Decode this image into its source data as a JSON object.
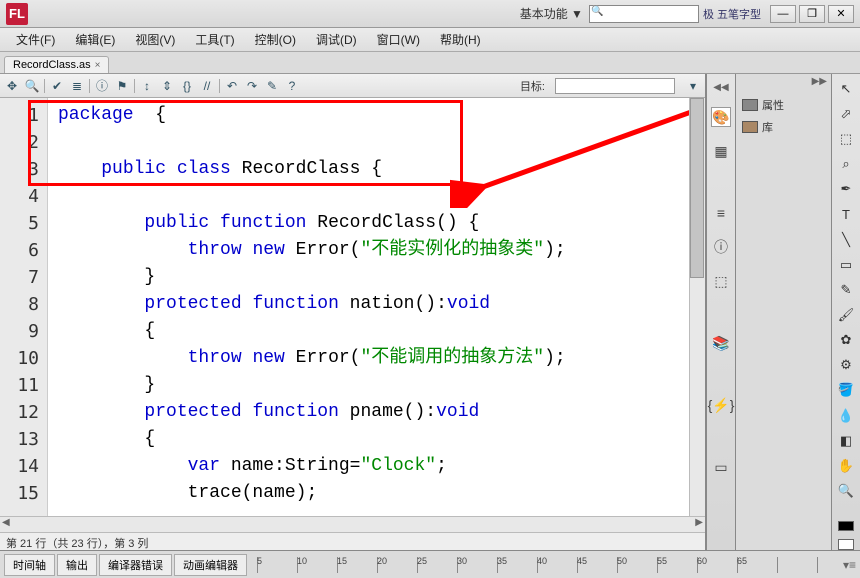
{
  "titlebar": {
    "logo": "FL",
    "mode": "基本功能 ▼",
    "ime": "极 五笔字型"
  },
  "winbtns": {
    "min": "—",
    "restore": "❐",
    "close": "✕"
  },
  "menu": [
    "文件(F)",
    "编辑(E)",
    "视图(V)",
    "工具(T)",
    "控制(O)",
    "调试(D)",
    "窗口(W)",
    "帮助(H)"
  ],
  "tab": {
    "name": "RecordClass.as",
    "close": "×"
  },
  "toolbar": {
    "target_label": "目标:"
  },
  "code_lines": [
    {
      "n": "1",
      "html": "<span class='kw'>package</span>  {"
    },
    {
      "n": "2",
      "html": ""
    },
    {
      "n": "3",
      "html": "    <span class='kw'>public</span> <span class='kw'>class</span> RecordClass {"
    },
    {
      "n": "4",
      "html": ""
    },
    {
      "n": "5",
      "html": "        <span class='kw'>public</span> <span class='kw'>function</span> RecordClass() {"
    },
    {
      "n": "6",
      "html": "            <span class='kw'>throw</span> <span class='kw'>new</span> Error(<span class='str'>\"不能实例化的抽象类\"</span>);"
    },
    {
      "n": "7",
      "html": "        }"
    },
    {
      "n": "8",
      "html": "        <span class='kw'>protected</span> <span class='kw'>function</span> nation():<span class='kw'>void</span>"
    },
    {
      "n": "9",
      "html": "        {"
    },
    {
      "n": "10",
      "html": "            <span class='kw'>throw</span> <span class='kw'>new</span> Error(<span class='str'>\"不能调用的抽象方法\"</span>);"
    },
    {
      "n": "11",
      "html": "        }"
    },
    {
      "n": "12",
      "html": "        <span class='kw'>protected</span> <span class='kw'>function</span> pname():<span class='kw'>void</span>"
    },
    {
      "n": "13",
      "html": "        {"
    },
    {
      "n": "14",
      "html": "            <span class='kw'>var</span> name:String=<span class='str'>\"Clock\"</span>;"
    },
    {
      "n": "15",
      "html": "            trace(name);"
    }
  ],
  "status": "第 21 行（共 23 行），第 3 列",
  "panels": {
    "prop": "属性",
    "lib": "库"
  },
  "bottom_tabs": [
    "时间轴",
    "输出",
    "编译器错误",
    "动画编辑器"
  ],
  "ruler_marks": [
    "5",
    "10",
    "15",
    "20",
    "25",
    "30",
    "35",
    "40",
    "45",
    "50",
    "55",
    "60",
    "65"
  ]
}
